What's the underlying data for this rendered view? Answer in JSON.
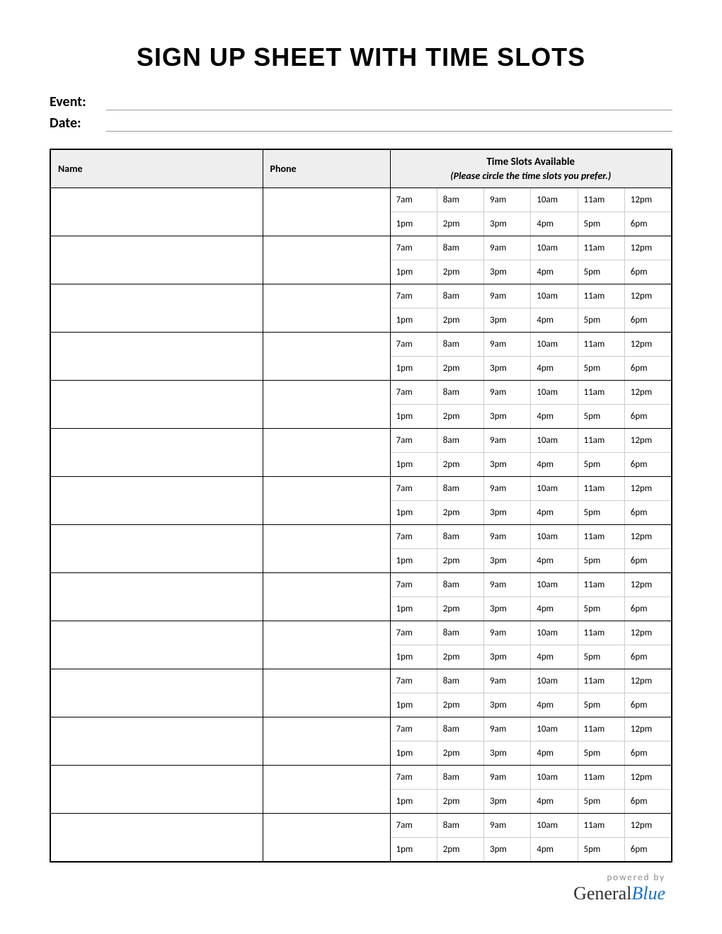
{
  "title": "SIGN UP SHEET WITH TIME SLOTS",
  "meta": {
    "event_label": "Event:",
    "event_value": "",
    "date_label": "Date:",
    "date_value": ""
  },
  "headers": {
    "name": "Name",
    "phone": "Phone",
    "slots_title": "Time Slots Available",
    "slots_subtitle": "(Please circle the time slots you prefer.)"
  },
  "time_rows": {
    "row1": [
      "7am",
      "8am",
      "9am",
      "10am",
      "11am",
      "12pm"
    ],
    "row2": [
      "1pm",
      "2pm",
      "3pm",
      "4pm",
      "5pm",
      "6pm"
    ]
  },
  "entry_count": 14,
  "footer": {
    "powered": "powered by",
    "brand_a": "General",
    "brand_b": "Blue"
  }
}
